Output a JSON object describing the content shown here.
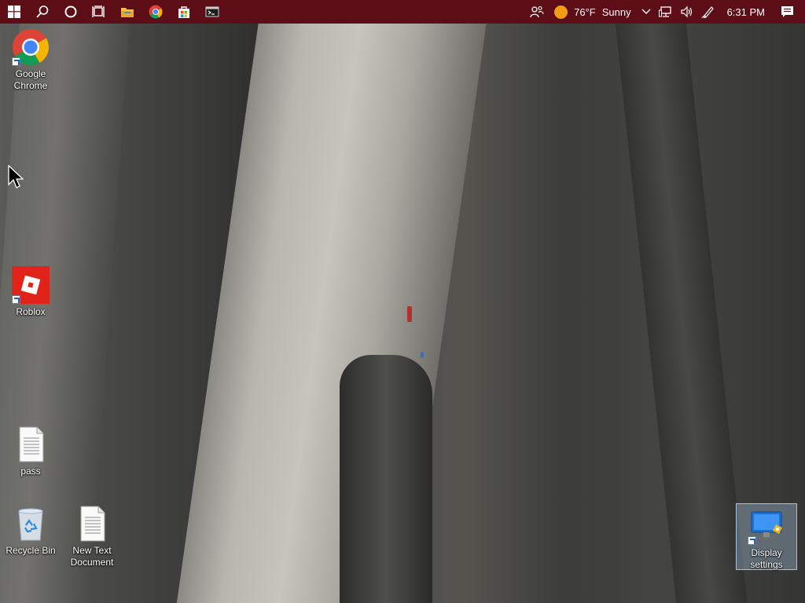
{
  "taskbar": {
    "apps": [
      "start-icon",
      "search-icon",
      "cortana-icon",
      "task-view-icon",
      "file-explorer-icon",
      "chrome-icon",
      "store-icon",
      "terminal-icon"
    ],
    "weather": {
      "temp": "76°F",
      "condition": "Sunny"
    },
    "clock": "6:31 PM",
    "colors": {
      "bar": "#5c0d16",
      "sun": "#f39c12"
    }
  },
  "desktop": {
    "icons": [
      {
        "label": "Google\nChrome",
        "icon": "chrome-icon"
      },
      {
        "label": "Roblox",
        "icon": "roblox-icon"
      },
      {
        "label": "pass",
        "icon": "text-file-icon"
      },
      {
        "label": "Recycle Bin",
        "icon": "recycle-bin-icon"
      },
      {
        "label": "New Text\nDocument",
        "icon": "text-file-icon"
      },
      {
        "label": "Display\nsettings",
        "icon": "display-settings-icon"
      }
    ]
  }
}
